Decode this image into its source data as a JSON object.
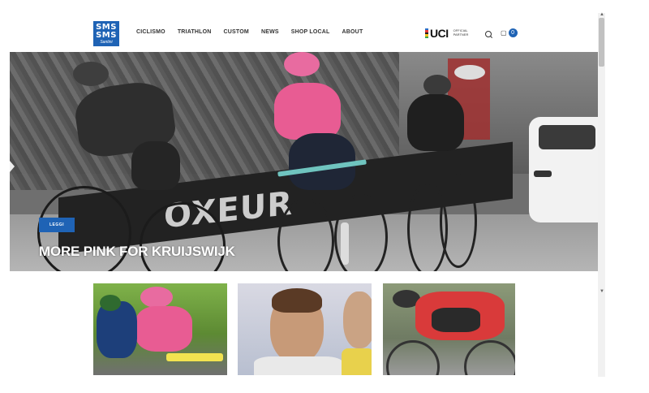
{
  "brand": {
    "logo_line1": "SMS",
    "logo_line2": "SMS",
    "logo_line3": "Santini",
    "color": "#1f63b5"
  },
  "nav": {
    "items": [
      "CICLISMO",
      "TRIATHLON",
      "CUSTOM",
      "NEWS",
      "SHOP LOCAL",
      "ABOUT"
    ]
  },
  "partner": {
    "name": "UCI",
    "subtitle_line1": "OFFICIAL",
    "subtitle_line2": "PARTNER"
  },
  "cart": {
    "count": "0",
    "icon": "cart-icon"
  },
  "search": {
    "icon": "search-icon"
  },
  "hero": {
    "button_label": "LEGGI",
    "title": "MORE PINK FOR KRUIJSWIJK",
    "banner_text": "OXEUR"
  },
  "thumbnails": [
    {
      "name": "thumbnail-pink-jersey-rider"
    },
    {
      "name": "thumbnail-riders-portrait"
    },
    {
      "name": "thumbnail-gcn-rider"
    }
  ]
}
